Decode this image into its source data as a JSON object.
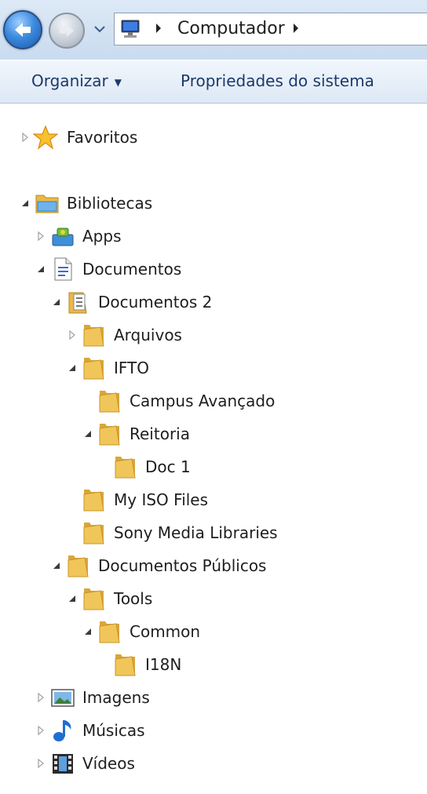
{
  "address_bar": {
    "breadcrumb": [
      "Computador"
    ]
  },
  "command_bar": {
    "organize_label": "Organizar",
    "system_properties_label": "Propriedades do sistema"
  },
  "tree": {
    "items": [
      {
        "label": "Favoritos",
        "icon": "star-icon",
        "expander": "collapsed"
      },
      {
        "label": "Bibliotecas",
        "icon": "library-icon",
        "expander": "expanded"
      },
      {
        "label": "Apps",
        "icon": "apps-icon",
        "expander": "collapsed"
      },
      {
        "label": "Documentos",
        "icon": "document-icon",
        "expander": "expanded"
      },
      {
        "label": "Documentos 2",
        "icon": "document-folder-icon",
        "expander": "expanded"
      },
      {
        "label": "Arquivos",
        "icon": "folder-icon",
        "expander": "collapsed"
      },
      {
        "label": "IFTO",
        "icon": "folder-icon",
        "expander": "expanded"
      },
      {
        "label": "Campus Avançado",
        "icon": "folder-icon",
        "expander": "none"
      },
      {
        "label": "Reitoria",
        "icon": "folder-icon",
        "expander": "expanded"
      },
      {
        "label": "Doc 1",
        "icon": "folder-icon",
        "expander": "none"
      },
      {
        "label": "My ISO Files",
        "icon": "folder-icon",
        "expander": "none"
      },
      {
        "label": "Sony Media Libraries",
        "icon": "folder-icon",
        "expander": "none"
      },
      {
        "label": "Documentos Públicos",
        "icon": "folder-icon",
        "expander": "expanded"
      },
      {
        "label": "Tools",
        "icon": "folder-icon",
        "expander": "expanded"
      },
      {
        "label": "Common",
        "icon": "folder-icon",
        "expander": "expanded"
      },
      {
        "label": "I18N",
        "icon": "folder-icon",
        "expander": "none"
      },
      {
        "label": "Imagens",
        "icon": "pictures-icon",
        "expander": "collapsed"
      },
      {
        "label": "Músicas",
        "icon": "music-icon",
        "expander": "collapsed"
      },
      {
        "label": "Vídeos",
        "icon": "videos-icon",
        "expander": "collapsed"
      }
    ]
  },
  "colors": {
    "command_text": "#1c3a6a",
    "folder": "#e8b84a",
    "expander_collapsed": "#a7a7a7",
    "expander_expanded": "#3b3b3b"
  }
}
